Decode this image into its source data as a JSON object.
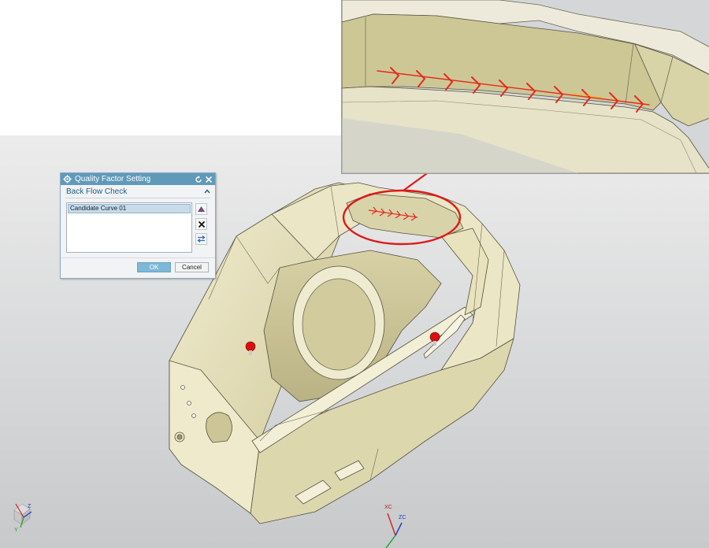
{
  "dialog": {
    "title": "Quality Factor Setting",
    "section_title": "Back Flow Check",
    "list_items": [
      "Candidate Curve 01"
    ],
    "ok_label": "OK",
    "cancel_label": "Cancel",
    "icons": {
      "title": "gear-icon",
      "reset": "reset-icon",
      "close": "close-icon",
      "collapse": "chevron-up-icon",
      "select_curve": "select-curve-icon",
      "remove": "remove-icon",
      "reverse": "reverse-direction-icon"
    }
  },
  "triads": {
    "work": {
      "xc": "XC",
      "zc": "ZC"
    },
    "view": {
      "z": "Z",
      "y": "Y"
    }
  },
  "colors": {
    "part_fill": "#e4dfbc",
    "background_top": "#eeeeee",
    "background_bottom": "#c9cbcd",
    "highlight": "#e01818",
    "dialog_title": "#5f9ab9",
    "flow_arrows": "#e42a1c"
  }
}
